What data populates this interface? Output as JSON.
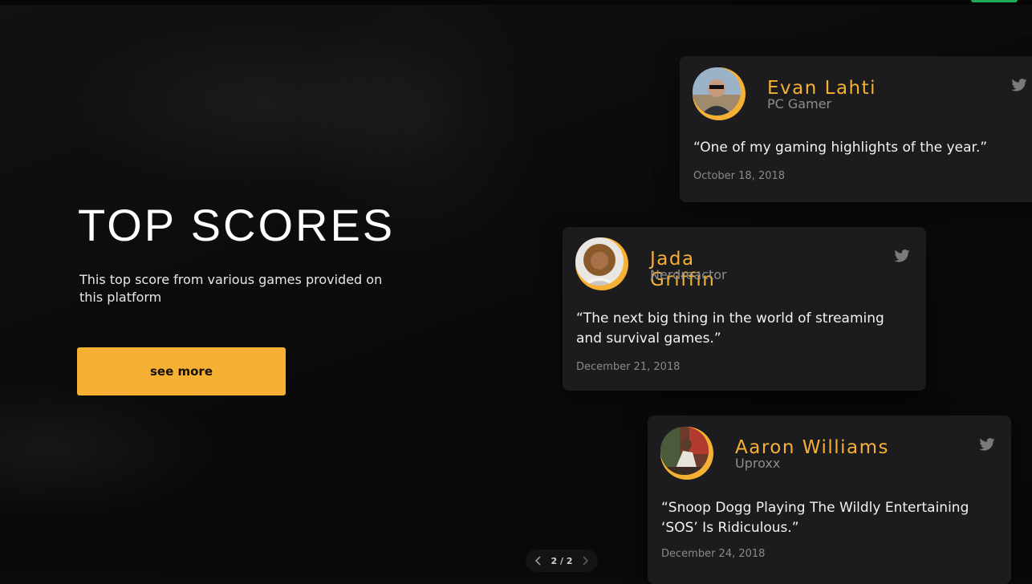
{
  "hero": {
    "title": "TOP SCORES",
    "description": "This top score from various games provided on this platform",
    "button_label": "see more"
  },
  "reviews": [
    {
      "name": "Evan Lahti",
      "outlet": "PC Gamer",
      "quote": "“One of my gaming highlights of the year.”",
      "date": "October 18, 2018",
      "icon": "twitter-icon"
    },
    {
      "name": "Jada Griffin",
      "outlet": "Nerdreactor",
      "quote": "“The next big thing in the world of streaming and survival games.”",
      "date": "December 21, 2018",
      "icon": "twitter-icon"
    },
    {
      "name": "Aaron Williams",
      "outlet": "Uproxx",
      "quote": "“Snoop Dogg Playing The Wildly Entertaining ‘SOS’ Is Ridiculous.”",
      "date": "December 24, 2018",
      "icon": "twitter-icon"
    }
  ],
  "pager": {
    "label": "2 / 2",
    "prev_icon": "chevron-left-icon",
    "next_icon": "chevron-right-icon"
  },
  "colors": {
    "accent": "#f6b034",
    "card_bg": "#1c1c1e",
    "page_bg": "#0b0b0c",
    "top_accent": "#1faa59"
  }
}
